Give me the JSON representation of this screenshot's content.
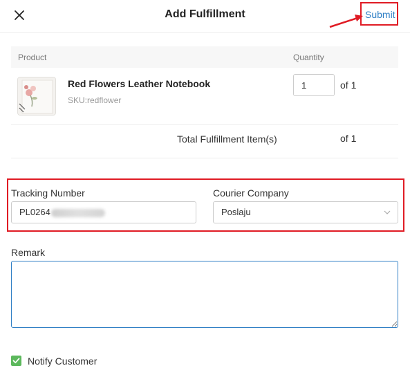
{
  "header": {
    "title": "Add Fulfillment",
    "submit_label": "Submit",
    "close_icon": "close-icon"
  },
  "table": {
    "col_product": "Product",
    "col_quantity": "Quantity",
    "product": {
      "name": "Red Flowers Leather Notebook",
      "sku": "SKU:redflower",
      "quantity": "1",
      "of_total": "of 1"
    },
    "total_label": "Total Fulfillment Item(s)",
    "total_of": "of 1"
  },
  "tracking": {
    "label": "Tracking Number",
    "value_visible": "PL0264"
  },
  "courier": {
    "label": "Courier Company",
    "selected": "Poslaju"
  },
  "remark": {
    "label": "Remark",
    "value": ""
  },
  "notify": {
    "label": "Notify Customer",
    "checked": true
  },
  "colors": {
    "accent": "#2f7fc5",
    "highlight": "#e01b24",
    "checkbox": "#5cb85c"
  }
}
